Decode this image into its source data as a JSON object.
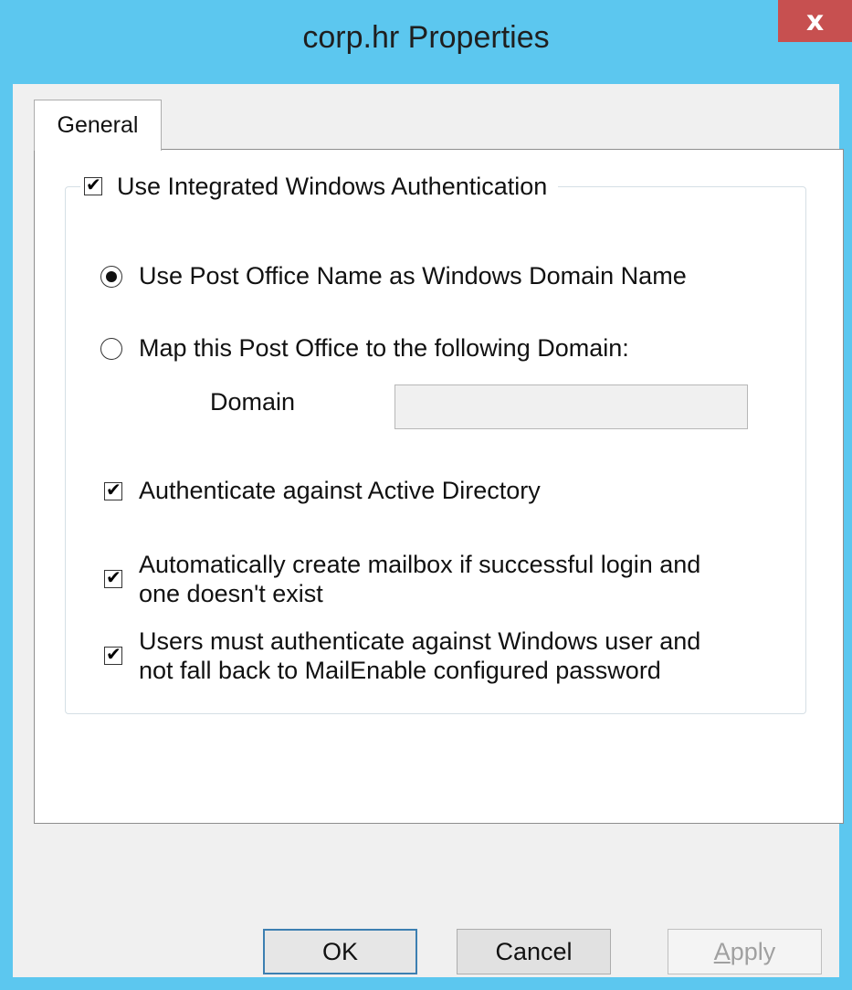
{
  "window": {
    "title": "corp.hr Properties",
    "close_glyph": "x"
  },
  "tabs": [
    {
      "label": "General",
      "selected": true
    }
  ],
  "group": {
    "legend_checkbox": {
      "label": "Use Integrated Windows Authentication",
      "checked": true
    }
  },
  "radios": [
    {
      "label": "Use Post Office Name as Windows Domain Name",
      "selected": true
    },
    {
      "label": "Map this Post Office to the following Domain:",
      "selected": false
    }
  ],
  "domain": {
    "label": "Domain",
    "value": ""
  },
  "checkboxes": [
    {
      "label": "Authenticate against Active Directory",
      "checked": true
    },
    {
      "label_line1": "Automatically create mailbox if successful login and",
      "label_line2": "one doesn't exist",
      "checked": true
    },
    {
      "label_line1": "Users must authenticate against Windows user and",
      "label_line2": "not fall back to MailEnable configured password",
      "checked": true
    }
  ],
  "buttons": {
    "ok": "OK",
    "cancel": "Cancel",
    "apply_accel": "A",
    "apply_rest": "pply"
  },
  "colors": {
    "title_bar": "#5cc7ef",
    "close_button": "#c75050"
  }
}
